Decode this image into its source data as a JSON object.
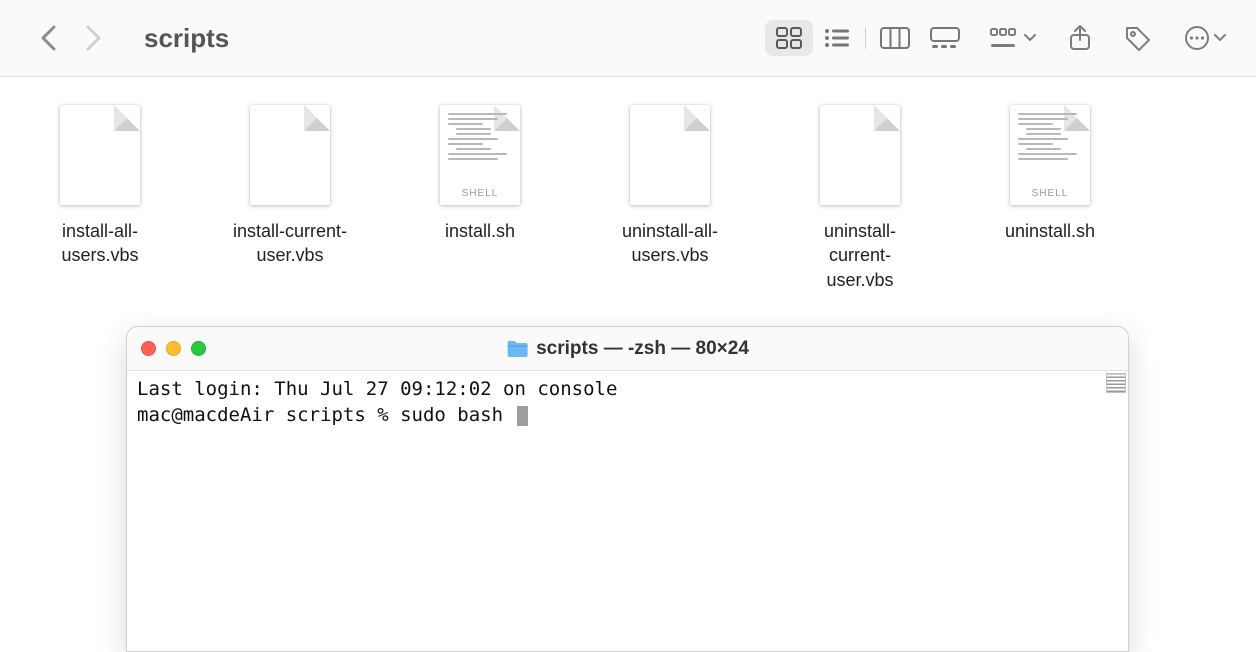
{
  "finder": {
    "folder_title": "scripts",
    "files": [
      {
        "name": "install-all-users.vbs",
        "kind": "vbs"
      },
      {
        "name": "install-current-user.vbs",
        "kind": "vbs"
      },
      {
        "name": "install.sh",
        "kind": "shell",
        "badge": "SHELL"
      },
      {
        "name": "uninstall-all-users.vbs",
        "kind": "vbs"
      },
      {
        "name": "uninstall-current-user.vbs",
        "kind": "vbs"
      },
      {
        "name": "uninstall.sh",
        "kind": "shell",
        "badge": "SHELL"
      }
    ]
  },
  "terminal": {
    "title_folder": "scripts",
    "title_rest": " — -zsh — 80×24",
    "line1": "Last login: Thu Jul 27 09:12:02 on console",
    "prompt": "mac@macdeAir scripts % ",
    "command": "sudo bash "
  }
}
